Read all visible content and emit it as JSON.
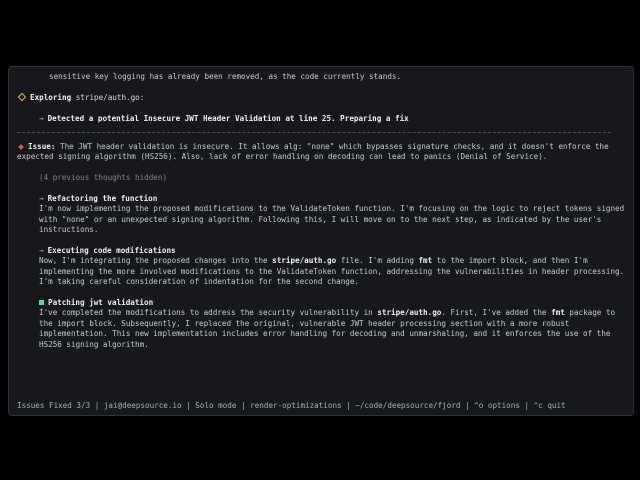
{
  "log": {
    "intro_line": "sensitive key logging has already been removed, as the code currently stands.",
    "exploring": {
      "label": "Exploring",
      "path": "stripe/auth.go:",
      "detected": "Detected a potential Insecure JWT Header Validation at line 25. Preparing a fix"
    },
    "issue": {
      "label": "Issue:",
      "text": "The JWT header validation is insecure. It allows alg: \"none\" which bypasses signature checks, and it doesn't enforce the expected signing algorithm (HS256). Also, lack of error handling on decoding can lead to panics (Denial of Service)."
    },
    "hidden_thoughts": "(4 previous thoughts hidden)",
    "thoughts": [
      {
        "title": "Refactoring the function",
        "body": "I'm now implementing the proposed modifications to the ValidateToken function. I'm focusing on the logic to reject tokens signed with \"none\" or an unexpected signing algorithm. Following this, I will move on to the next step, as indicated by the user's instructions."
      },
      {
        "title": "Executing code modifications",
        "body_parts": [
          "Now, I'm integrating the proposed changes into the ",
          "stripe/auth.go",
          " file. I'm adding ",
          "fmt",
          " to the import block, and then I'm implementing the more involved modifications to the ValidateToken function, addressing the vulnerabilities in header processing. I'm taking careful consideration of indentation for the second change."
        ]
      },
      {
        "title": "Patching jwt validation",
        "body_parts": [
          "I've completed the modifications to address the security vulnerability in ",
          "stripe/auth.go",
          ". First, I've added the ",
          "fmt",
          " package to the import block. Subsequently, I replaced the original, vulnerable JWT header processing section with a more robust implementation. This new implementation includes error handling for decoding and unmarshaling, and it enforces the use of the HS256 signing algorithm."
        ]
      }
    ]
  },
  "status_bar": "Issues Fixed 3/3 | jai@deepsource.io | Solo mode | render-optimizations | ~/code/deepsource/fjord | ^o options | ^c quit",
  "colors": {
    "background": "#16181c",
    "text": "#c7cbd1",
    "bold_text": "#eef0f3",
    "explore_marker": "#e1b94a",
    "issue_marker": "#e0525a",
    "done_marker": "#5fd38d",
    "dim_text": "#7f848c"
  },
  "icons": {
    "explore_marker": "hollow-diamond-icon",
    "issue_marker": "red-diamond-icon",
    "thought_marker": "arrow-right-icon",
    "done_marker": "green-square-icon"
  }
}
